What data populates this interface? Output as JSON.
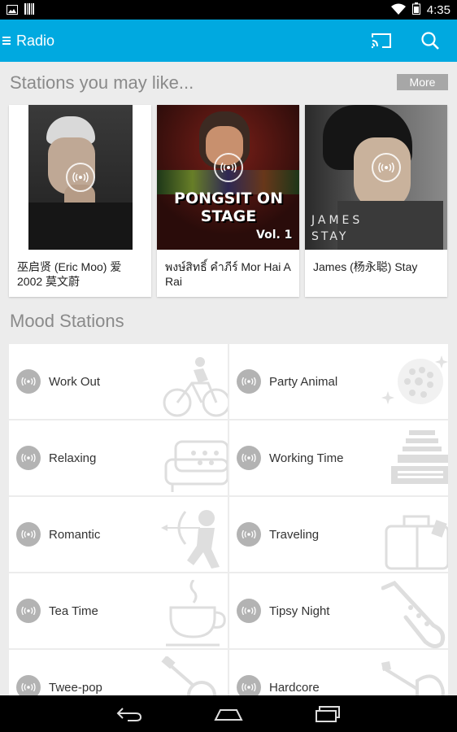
{
  "status_bar": {
    "time": "4:35",
    "icons": [
      "image-icon",
      "barcode-icon",
      "wifi-icon",
      "battery-icon"
    ]
  },
  "app_bar": {
    "title": "Radio",
    "background": "#00a9e0",
    "icons": [
      "menu-icon",
      "cast-icon",
      "search-icon"
    ]
  },
  "recommended": {
    "title": "Stations you may like...",
    "more_label": "More",
    "cards": [
      {
        "label": "巫启贤 (Eric Moo) 爱 2002 莫文蔚"
      },
      {
        "label": "พงษ์สิทธิ์ คำภีร์ Mor Hai A Rai",
        "art_text": "PONGSIT ON STAGE",
        "art_sub": "Vol. 1"
      },
      {
        "label": "James (杨永聪) Stay",
        "art_text": "JAMES",
        "art_sub": "STAY"
      }
    ]
  },
  "mood": {
    "title": "Mood Stations",
    "stations": [
      {
        "label": "Work Out",
        "art": "cyclist"
      },
      {
        "label": "Party Animal",
        "art": "disco-ball"
      },
      {
        "label": "Relaxing",
        "art": "sofa"
      },
      {
        "label": "Working Time",
        "art": "typewriter"
      },
      {
        "label": "Romantic",
        "art": "cupid"
      },
      {
        "label": "Traveling",
        "art": "suitcase"
      },
      {
        "label": "Tea Time",
        "art": "teacup"
      },
      {
        "label": "Tipsy Night",
        "art": "saxophone"
      },
      {
        "label": "Twee-pop",
        "art": "ukulele"
      },
      {
        "label": "Hardcore",
        "art": "electric-guitar"
      }
    ]
  },
  "nav_bar": {
    "icons": [
      "back-icon",
      "home-icon",
      "recents-icon"
    ]
  }
}
